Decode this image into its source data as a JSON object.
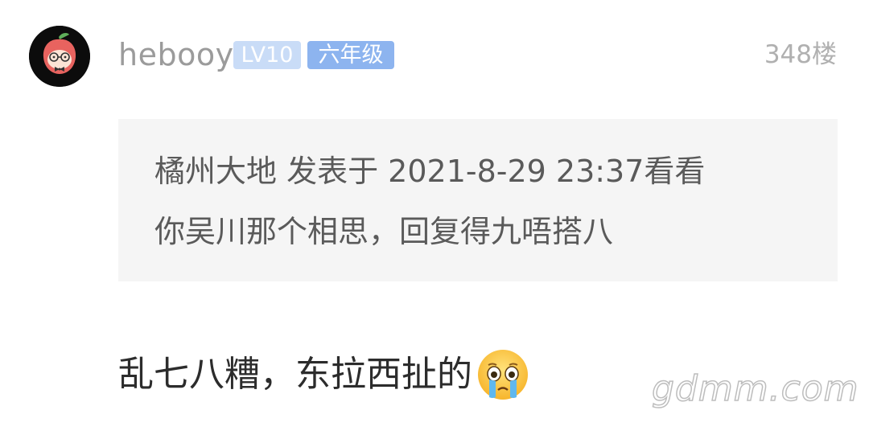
{
  "post": {
    "username": "hebooy",
    "level_badge": "LV10",
    "grade_badge": "六年级",
    "floor": "348楼",
    "avatar_icon": "cartoon-peach-avatar-icon",
    "colors": {
      "level_badge_bg": "#c9dcf7",
      "grade_badge_bg": "#8db4ef",
      "quote_bg": "#f5f5f5"
    }
  },
  "quote": {
    "line1": "橘州大地 发表于 2021-8-29 23:37看看",
    "line2": "你吴川那个相思，回复得九唔搭八"
  },
  "reply": {
    "text": "乱七八糟，东拉西扯的",
    "emoji": "crying-face-emoji-icon"
  },
  "watermark": {
    "text": "gdmm.com"
  }
}
